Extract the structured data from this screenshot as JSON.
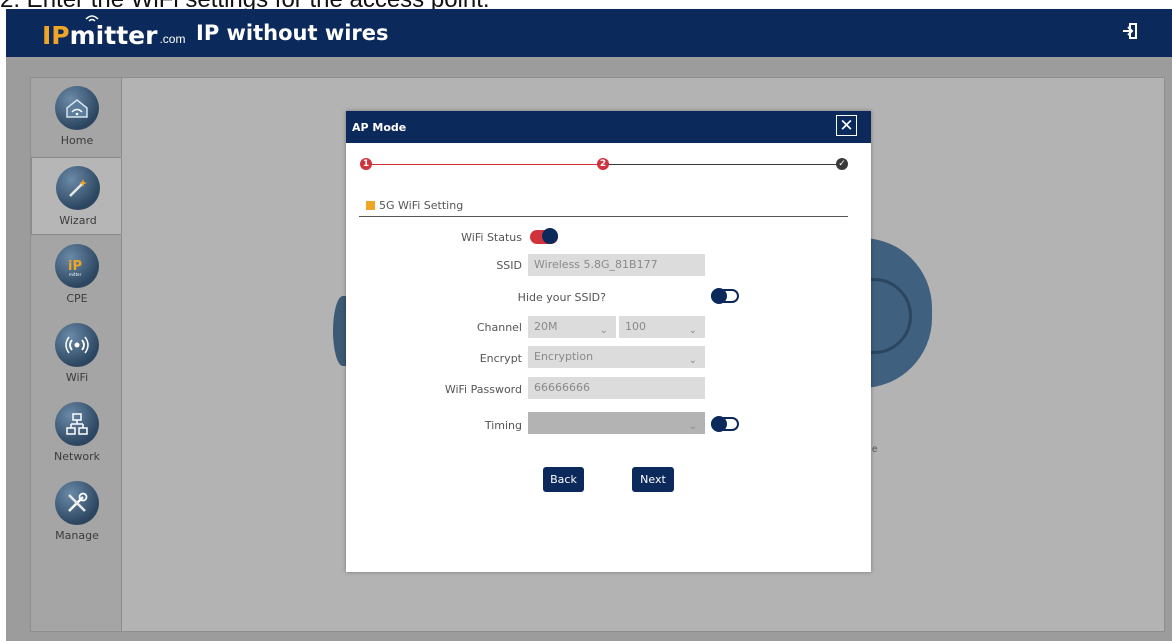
{
  "caption": "2. Enter the WiFi settings for the access point.",
  "header": {
    "brand_ip": "IP",
    "brand_mitter": "mitter",
    "brand_domain": ".com",
    "title": "IP without wires",
    "logout_icon": "logout-icon"
  },
  "sidebar": {
    "items": [
      {
        "label": "Home",
        "icon": "home-wifi-icon"
      },
      {
        "label": "Wizard",
        "icon": "wizard-wand-icon",
        "active": true
      },
      {
        "label": "CPE",
        "icon": "cpe-ipmitter-icon"
      },
      {
        "label": "WiFi",
        "icon": "wifi-signal-icon"
      },
      {
        "label": "Network",
        "icon": "network-icon"
      },
      {
        "label": "Manage",
        "icon": "manage-tools-icon"
      }
    ]
  },
  "background": {
    "fragment_text": "e"
  },
  "modal": {
    "title": "AP Mode",
    "close_glyph": "✕",
    "steps": [
      "1",
      "2",
      "✓"
    ],
    "section_title": "5G WiFi Setting",
    "wifi_status_label": "WiFi Status",
    "wifi_status_on": true,
    "ssid_label": "SSID",
    "ssid_value": "Wireless 5.8G_81B177",
    "hide_ssid_label": "Hide your SSID?",
    "hide_ssid_on": false,
    "channel_label": "Channel",
    "channel_width": "20M",
    "channel_number": "100",
    "encrypt_label": "Encrypt",
    "encrypt_value": "Encryption",
    "password_label": "WiFi Password",
    "password_value": "66666666",
    "timing_label": "Timing",
    "timing_on": false,
    "back_label": "Back",
    "next_label": "Next"
  },
  "colors": {
    "navy": "#0b2a5b",
    "accent_orange": "#f0a526",
    "step_red": "#d0333b"
  }
}
